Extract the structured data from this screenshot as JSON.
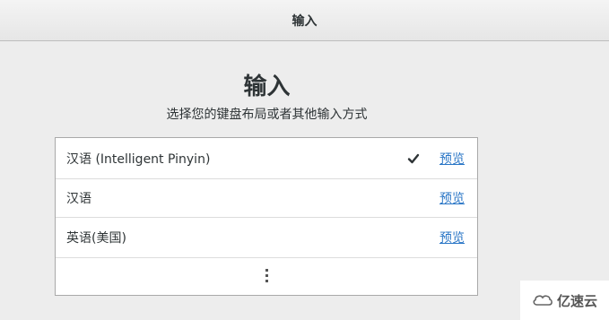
{
  "header": {
    "title": "输入"
  },
  "page": {
    "title": "输入",
    "subtitle": "选择您的键盘布局或者其他输入方式"
  },
  "sources": [
    {
      "label": "汉语 (Intelligent Pinyin)",
      "selected": true,
      "preview_label": "预览"
    },
    {
      "label": "汉语",
      "selected": false,
      "preview_label": "预览"
    },
    {
      "label": "英语(美国)",
      "selected": false,
      "preview_label": "预览"
    }
  ],
  "more": {
    "icon": "vertical-ellipsis-icon"
  },
  "watermark": {
    "text": "亿速云"
  },
  "colors": {
    "link": "#2a76c6",
    "background": "#ededed"
  }
}
